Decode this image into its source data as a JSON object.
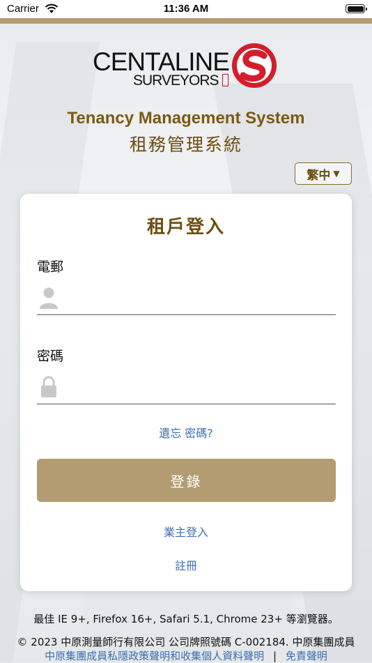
{
  "status_bar": {
    "carrier": "Carrier",
    "time": "11:36 AM"
  },
  "logo": {
    "line1": "CENTALINE",
    "line2": "SURVEYORS"
  },
  "header": {
    "title_en": "Tenancy Management System",
    "title_zh": "租務管理系統"
  },
  "language": {
    "selected": "繁中"
  },
  "login_card": {
    "title": "租戶登入",
    "email_label": "電郵",
    "email_value": "",
    "password_label": "密碼",
    "password_value": "",
    "forgot_password": "遺忘 密碼?",
    "login_button": "登錄",
    "owner_login": "業主登入",
    "register": "註冊"
  },
  "footer": {
    "browser_note": "最佳 IE 9+, Firefox 16+, Safari 5.1, Chrome 23+ 等瀏覽器。",
    "copyright": "© 2023 中原測量師行有限公司 公司牌照號碼 C-002184. 中原集團成員",
    "privacy_link": "中原集團成員私隱政策聲明和收集個人資料聲明",
    "separator": "|",
    "disclaimer_link": "免責聲明"
  },
  "colors": {
    "brand_gold": "#b39c72",
    "title_brown": "#7a5a12",
    "link_blue": "#3d6fb0",
    "logo_red": "#d21f2b"
  },
  "icons": [
    "wifi-icon",
    "battery-icon",
    "user-icon",
    "lock-icon",
    "chevron-down-icon"
  ]
}
